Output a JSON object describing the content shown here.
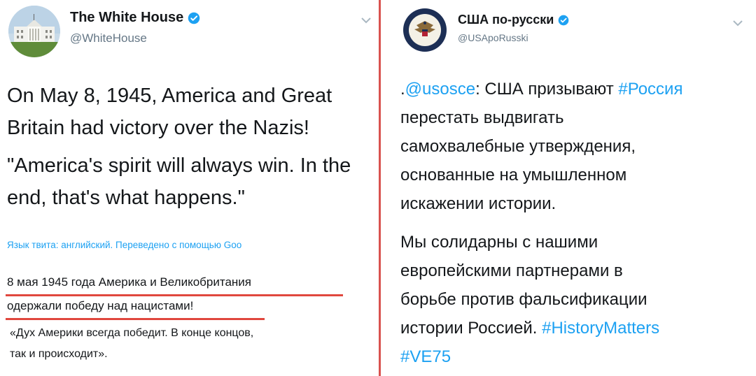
{
  "left_tweet": {
    "display_name": "The White House",
    "handle": "@WhiteHouse",
    "paragraph1_lines": [
      "On May 8, 1945, America and Great",
      "Britain had victory over the Nazis!"
    ],
    "paragraph2_lines": [
      "\"America's spirit will always win. In the",
      "end, that's what happens.\""
    ],
    "translation_note": "Язык твита: английский. Переведено с помощью Goo",
    "translated_line1": "8 мая 1945 года Америка и Великобритания",
    "translated_line2": "одержали победу над нацистами!",
    "translated_quote_lines": [
      "«Дух Америки всегда победит. В конце концов,",
      "так и происходит»."
    ]
  },
  "right_tweet": {
    "display_name": "США по-русски",
    "handle": "@USApoRusski",
    "p1_line1_prefix": ".",
    "p1_mention": "@usosce",
    "p1_line1_middle": ": США призывают ",
    "p1_hashtag": "#Россия",
    "p1_lines_rest": [
      "перестать выдвигать",
      "самохвалебные утверждения,",
      "основанные на умышленном",
      "искажении истории."
    ],
    "p2_lines": [
      "Мы солидарны с нашими",
      "европейскими партнерами в",
      "борьбе против фальсификации"
    ],
    "p2_last_prefix": "истории Россией. ",
    "p2_hashtag1": "#HistoryMatters",
    "p2_hashtag2": "#VE75"
  },
  "colors": {
    "link": "#1da1f2",
    "underline": "#e0473e",
    "divider": "#d9534f",
    "handle": "#657786"
  },
  "icons": [
    "white-house-avatar",
    "state-department-seal-avatar",
    "verified-badge-icon",
    "chevron-down-icon"
  ]
}
